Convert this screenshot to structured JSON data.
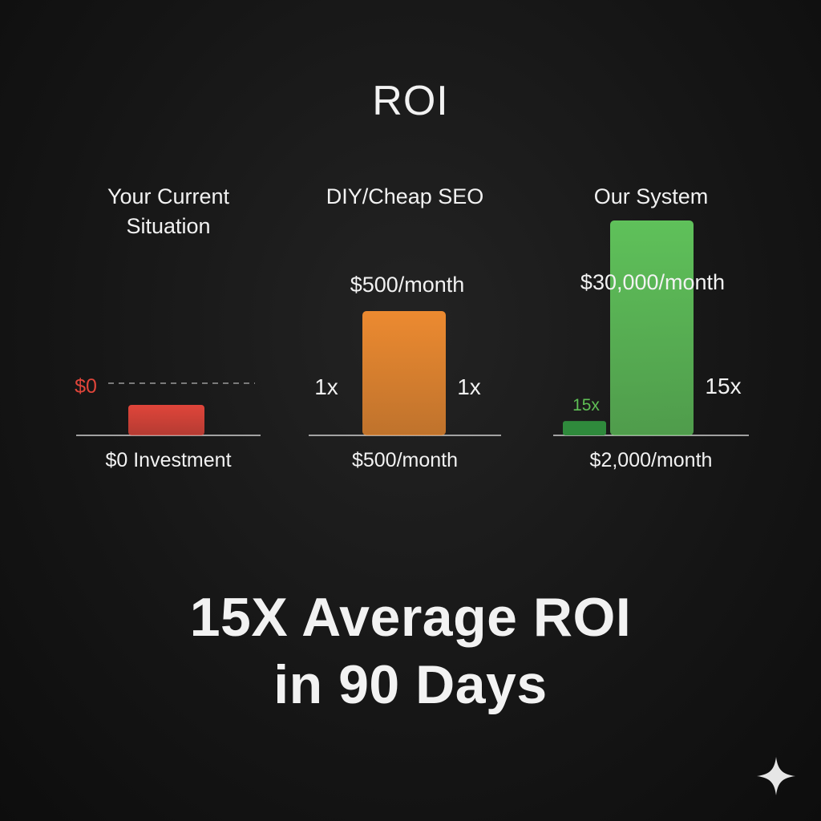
{
  "title": "ROI",
  "headline": {
    "line1": "15X Average ROI",
    "line2": "in 90 Days"
  },
  "chart_data": {
    "type": "bar",
    "title": "ROI",
    "panels": [
      {
        "heading": [
          "Your Current",
          "Situation"
        ],
        "bottom_label": "$0 Investment",
        "bar_color": "#e0453a",
        "investment": 0,
        "return": 0,
        "top_label": "",
        "top_label_color": "#e0453a",
        "reference_label": "$0",
        "left_multiplier": "",
        "right_multiplier": "",
        "small_bar_label": ""
      },
      {
        "heading": [
          "DIY/Cheap SEO"
        ],
        "bottom_label": "$500/month",
        "bar_color": "#ec8a30",
        "investment": 500,
        "return": 500,
        "top_label": "$500/month",
        "left_multiplier": "1x",
        "right_multiplier": "1x",
        "small_bar_label": ""
      },
      {
        "heading": [
          "Our System"
        ],
        "bottom_label": "$2,000/month",
        "bar_color": "#5fc15a",
        "small_bar_color": "#2f8a3c",
        "investment": 2000,
        "return": 30000,
        "top_label": "$30,000/month",
        "left_multiplier": "",
        "right_multiplier": "15x",
        "small_bar_label": "15x",
        "small_bar_label_color": "#5fbf55"
      }
    ]
  },
  "icons": {
    "corner": "sparkle-icon"
  }
}
